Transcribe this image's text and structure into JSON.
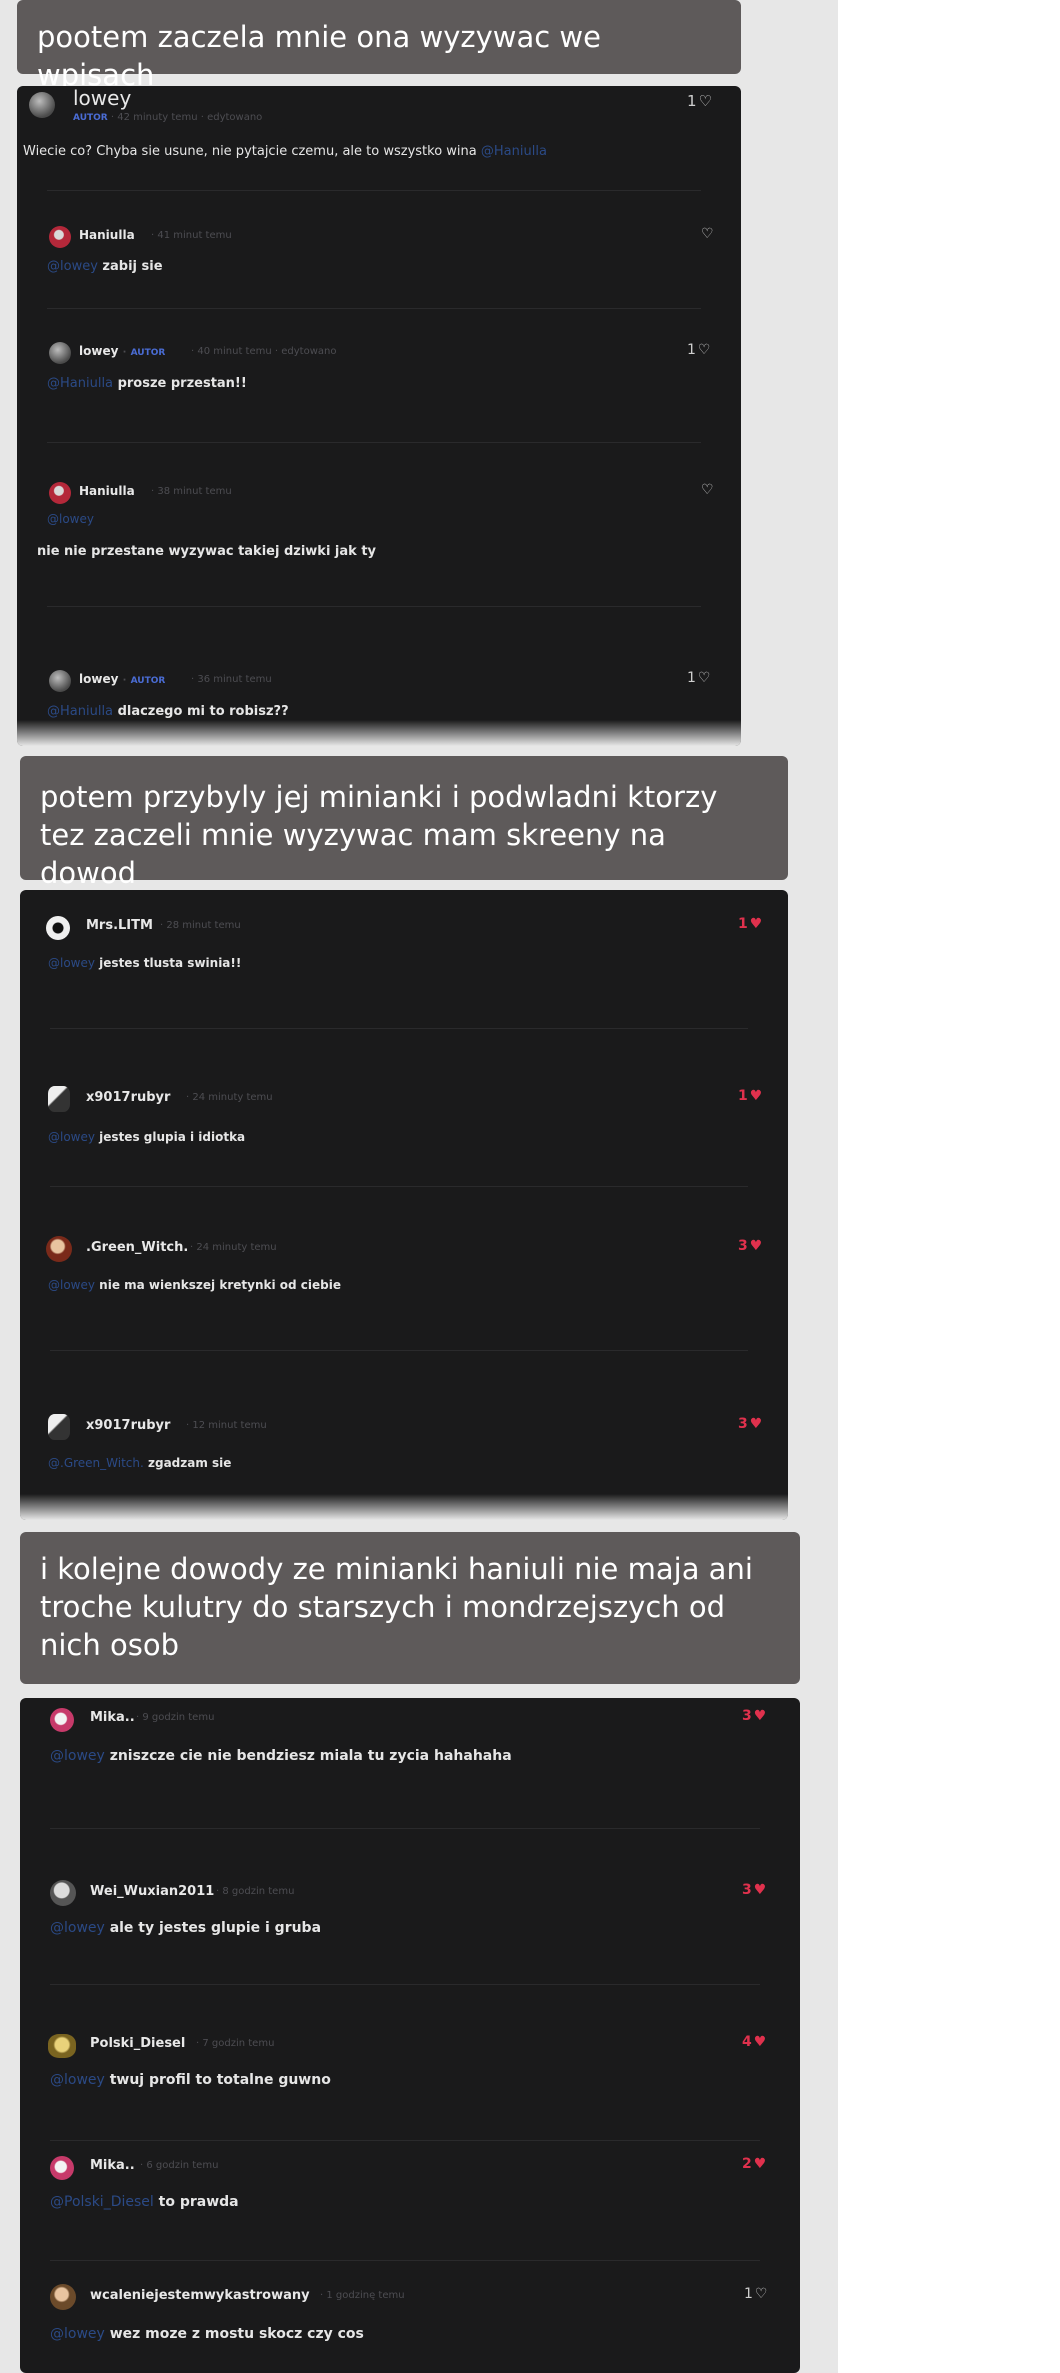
{
  "captions": [
    "pootem zaczela mnie ona wyzywac we wpisach",
    "potem przybyly jej minianki i podwladni ktorzy tez zaczeli mnie wyzywac mam skreeny na dowod",
    "i kolejne dowody ze minianki haniuli nie maja ani troche kulutry do starszych i mondrzejszych od nich osob"
  ],
  "shot1": {
    "post": {
      "author": "lowey",
      "autor_badge": "AUTOR",
      "meta": "· 42 minuty temu · edytowano",
      "likes": "1",
      "text": "Wiecie co? Chyba sie usune, nie pytajcie czemu, ale to wszystko wina",
      "mention": "@Haniulla"
    },
    "comments": [
      {
        "author": "Haniulla",
        "meta": "· 41 minut temu",
        "mention": "@lowey",
        "text": "zabij sie",
        "likes": ""
      },
      {
        "author": "lowey",
        "autor_badge": "AUTOR",
        "meta": "· 40 minut temu · edytowano",
        "mention": "@Haniulla",
        "text": "prosze przestan!!",
        "likes": "1"
      },
      {
        "author": "Haniulla",
        "meta": "· 38 minut temu",
        "mention": "@lowey",
        "text": "nie nie przestane wyzywac takiej dziwki jak ty",
        "likes": ""
      },
      {
        "author": "lowey",
        "autor_badge": "AUTOR",
        "meta": "· 36 minut temu",
        "mention": "@Haniulla",
        "text": "dlaczego mi to robisz??",
        "likes": "1"
      }
    ]
  },
  "shot2": {
    "comments": [
      {
        "author": "Mrs.LITM",
        "meta": "· 28 minut temu",
        "mention": "@lowey",
        "text": "jestes tlusta swinia!!",
        "likes": "1"
      },
      {
        "author": "x9017rubyr",
        "meta": "· 24 minuty temu",
        "mention": "@lowey",
        "text": "jestes glupia i idiotka",
        "likes": "1"
      },
      {
        "author": ".Green_Witch.",
        "meta": "· 24 minuty temu",
        "mention": "@lowey",
        "text": "nie ma wienkszej kretynki od ciebie",
        "likes": "3"
      },
      {
        "author": "x9017rubyr",
        "meta": "· 12 minut temu",
        "mention": "@.Green_Witch.",
        "text": "zgadzam sie",
        "likes": "3"
      }
    ]
  },
  "shot3": {
    "comments": [
      {
        "author": "Mika..",
        "meta": "· 9 godzin temu",
        "mention": "@lowey",
        "text": "zniszcze cie nie bendziesz miala tu zycia hahahaha",
        "likes": "3"
      },
      {
        "author": "Wei_Wuxian2011",
        "meta": "· 8 godzin temu",
        "mention": "@lowey",
        "text": "ale ty jestes glupie i gruba",
        "likes": "3"
      },
      {
        "author": "Polski_Diesel",
        "meta": "· 7 godzin temu",
        "mention": "@lowey",
        "text": "twuj profil to totalne guwno",
        "likes": "4"
      },
      {
        "author": "Mika..",
        "meta": "· 6 godzin temu",
        "mention": "@Polski_Diesel",
        "text": "to prawda",
        "likes": "2"
      },
      {
        "author": "wcaleniejestemwykastrowany",
        "meta": "· 1 godzinę temu",
        "mention": "@lowey",
        "text": "wez moze z mostu skocz czy cos",
        "likes": "1"
      }
    ]
  },
  "colors": {
    "caption_bg": "#5e5a5a",
    "screenshot_bg": "#1a1a1b",
    "mention": "#2b4a86",
    "like_red": "#e0314d",
    "autor_badge": "#4a6cd4"
  },
  "icons": {
    "heart_outline": "heart-outline-icon",
    "heart_filled": "heart-filled-icon"
  }
}
